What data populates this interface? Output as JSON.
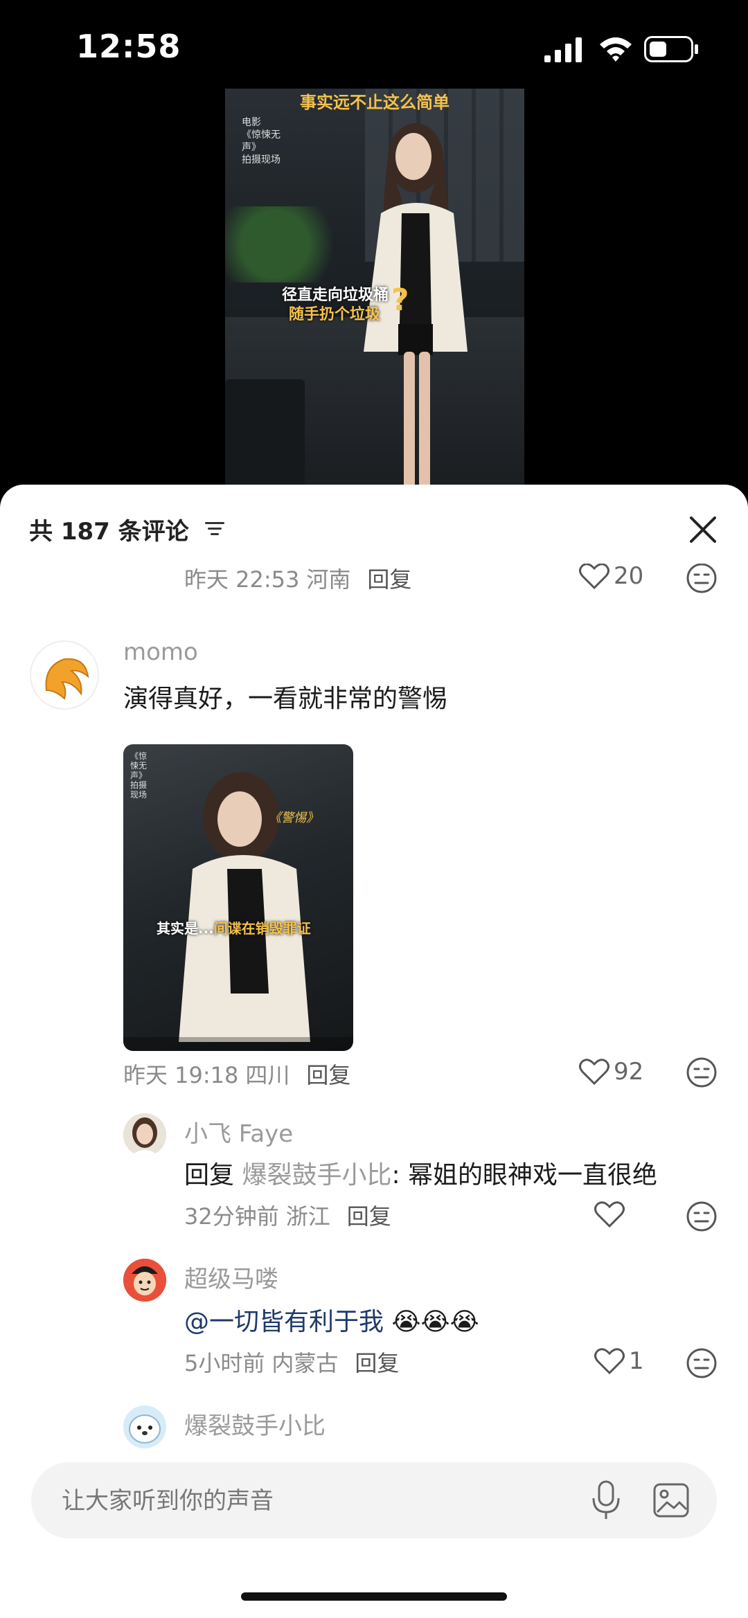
{
  "status_bar": {
    "time": "12:58"
  },
  "video": {
    "title_text": "事实远不止这么简单",
    "side_text": "电影\n《惊悚无声》\n拍摄现场",
    "caption_line1": "径直走向垃圾桶",
    "caption_line2": "随手扔个垃圾",
    "caption_mark": "?"
  },
  "sheet": {
    "comment_count": "共 187 条评论",
    "cut_comment": {
      "time": "昨天 22:53",
      "region": "河南",
      "reply": "回复",
      "likes": "20"
    }
  },
  "comments": [
    {
      "username": "momo",
      "text": "演得真好，一看就非常的警惕",
      "image": {
        "caption_prefix": "其实是...",
        "caption_highlight": "间谍在销毁罪证",
        "tag": "《警惕》",
        "side_text": "《惊悚无声》拍摄现场"
      },
      "time": "昨天 19:18",
      "region": "四川",
      "reply": "回复",
      "likes": "92"
    }
  ],
  "replies": [
    {
      "username": "小飞 Faye",
      "prefix": "回复",
      "target": "爆裂鼓手小比",
      "text": ": 幂姐的眼神戏一直很绝",
      "time": "32分钟前",
      "region": "浙江",
      "reply": "回复"
    },
    {
      "username": "超级马喽",
      "text": "@一切皆有利于我",
      "emoji": "😭😭😭",
      "time": "5小时前",
      "region": "内蒙古",
      "reply": "回复",
      "likes": "1"
    },
    {
      "username": "爆裂鼓手小比"
    }
  ],
  "input": {
    "placeholder": "让大家听到你的声音"
  },
  "colors": {
    "accent_yellow": "#f5c24a",
    "text_primary": "#1b1b1b",
    "text_meta": "#8a8a8a",
    "link_blue": "#1f3a6b"
  }
}
